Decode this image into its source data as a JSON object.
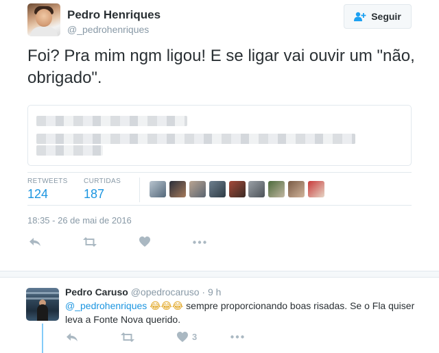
{
  "tweet": {
    "author": {
      "name": "Pedro Henriques",
      "handle": "@_pedrohenriques"
    },
    "follow_label": "Seguir",
    "text": "Foi? Pra mim ngm ligou! E se ligar vai ouvir um \"não, obrigado\".",
    "stats": {
      "retweets_label": "RETWEETS",
      "retweets_count": "124",
      "likes_label": "CURTIDAS",
      "likes_count": "187"
    },
    "timestamp": "18:35 - 26 de mai de 2016",
    "icons": [
      "reply-icon",
      "retweet-icon",
      "heart-icon",
      "more-icon"
    ]
  },
  "reply": {
    "name": "Pedro Caruso",
    "handle": "@opedrocaruso",
    "time": "· 9 h",
    "mention": "@_pedrohenriques",
    "emojis": "😂😂😂",
    "text": " sempre proporcionando boas risadas. Se o Fla quiser leva a Fonte Nova querido.",
    "like_count": "3"
  },
  "colors": {
    "link": "#1b95e0",
    "muted": "#8899a6",
    "action_icon": "#aab8c2",
    "border": "#e1e8ed"
  }
}
